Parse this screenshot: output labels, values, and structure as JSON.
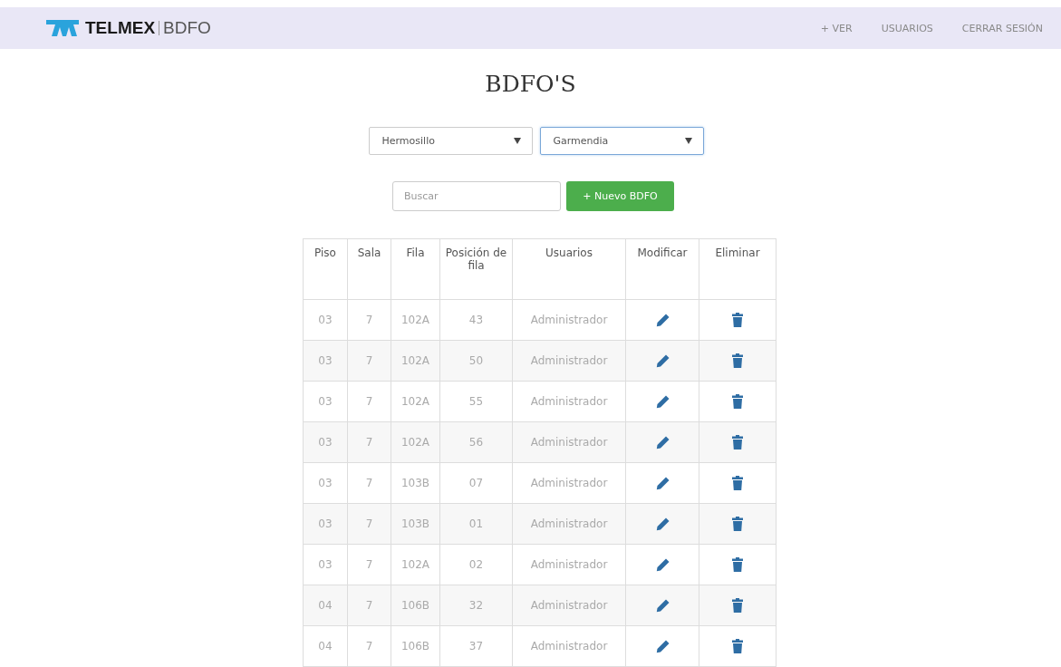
{
  "navbar": {
    "brand": "TELMEX",
    "product": "BDFO",
    "links": [
      {
        "label": "+ VER"
      },
      {
        "label": "USUARIOS"
      },
      {
        "label": "CERRAR SESIÓN"
      }
    ]
  },
  "title": "BDFO'S",
  "filters": [
    {
      "value": "Hermosillo",
      "focused": false
    },
    {
      "value": "Garmendia",
      "focused": true
    }
  ],
  "search": {
    "placeholder": "Buscar"
  },
  "new_button": "+ Nuevo BDFO",
  "table": {
    "columns": [
      "Piso",
      "Sala",
      "Fila",
      "Posición de fila",
      "Usuarios",
      "Modificar",
      "Eliminar"
    ],
    "rows": [
      [
        "03",
        "7",
        "102A",
        "43",
        "Administrador"
      ],
      [
        "03",
        "7",
        "102A",
        "50",
        "Administrador"
      ],
      [
        "03",
        "7",
        "102A",
        "55",
        "Administrador"
      ],
      [
        "03",
        "7",
        "102A",
        "56",
        "Administrador"
      ],
      [
        "03",
        "7",
        "103B",
        "07",
        "Administrador"
      ],
      [
        "03",
        "7",
        "103B",
        "01",
        "Administrador"
      ],
      [
        "03",
        "7",
        "102A",
        "02",
        "Administrador"
      ],
      [
        "04",
        "7",
        "106B",
        "32",
        "Administrador"
      ],
      [
        "04",
        "7",
        "106B",
        "37",
        "Administrador"
      ]
    ]
  }
}
